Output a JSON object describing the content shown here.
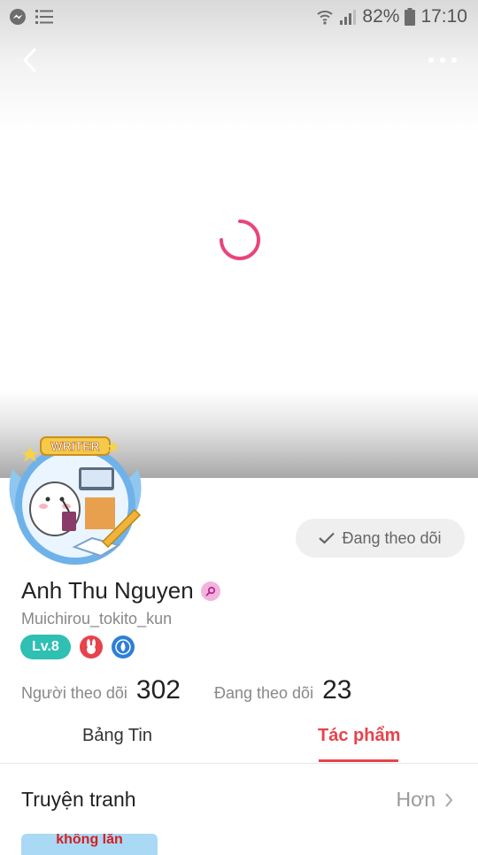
{
  "status_bar": {
    "battery": "82%",
    "time": "17:10"
  },
  "profile": {
    "avatar_badge_text": "WRITER",
    "follow_button_label": "Đang theo dõi",
    "name": "Anh Thu Nguyen",
    "username": "Muichirou_tokito_kun",
    "level": "Lv.8"
  },
  "stats": {
    "followers_label": "Người theo dõi",
    "followers_count": "302",
    "following_label": "Đang theo dõi",
    "following_count": "23"
  },
  "tabs": [
    {
      "label": "Bảng Tin",
      "active": false
    },
    {
      "label": "Tác phẩm",
      "active": true
    }
  ],
  "section": {
    "title": "Truyện tranh",
    "more_label": "Hơn"
  },
  "works": [
    {
      "thumb_text": "không lăn"
    }
  ],
  "colors": {
    "accent": "#e8424c",
    "spinner": "#e8457a",
    "level_badge": "#2fbfb3",
    "follow_button_bg": "#efefef"
  }
}
